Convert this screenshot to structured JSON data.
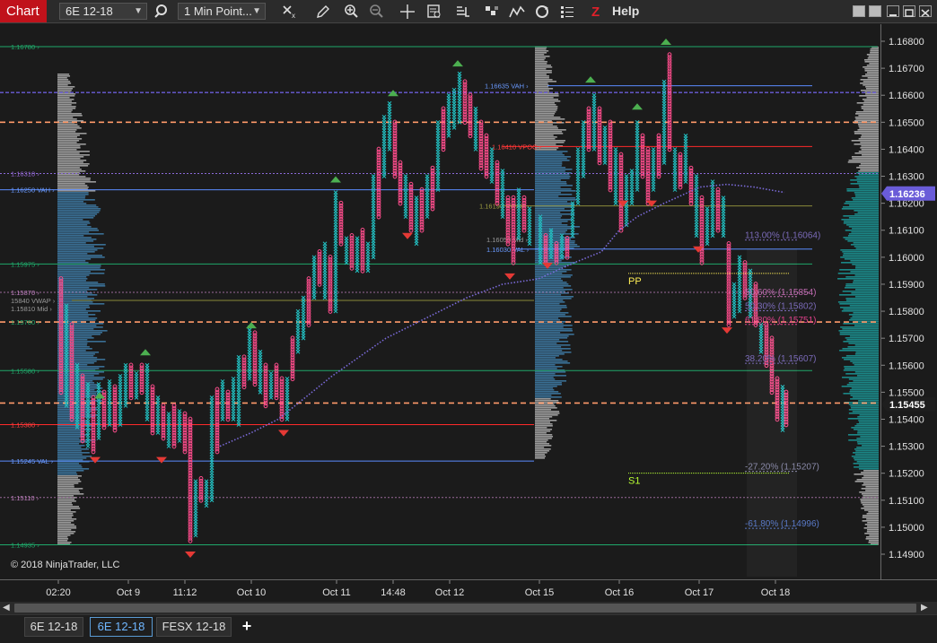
{
  "window": {
    "title": "Chart",
    "instrument": "6E 12-18",
    "interval": "1 Min Point...",
    "help_label": "Help"
  },
  "toolbar": {
    "icons": [
      "search-icon",
      "crosshair-remove-icon",
      "pencil-icon",
      "zoom-in-icon",
      "zoom-out-icon",
      "crosshair-icon",
      "data-box-icon",
      "bar-chart-icon",
      "strategy-icon",
      "indicator-icon",
      "refresh-icon",
      "properties-icon",
      "zlogo-icon"
    ]
  },
  "chart": {
    "copyright": "© 2018 NinjaTrader, LLC",
    "current_price_label": "1.16236",
    "last_price_label": "1.15455",
    "price_axis_ticks": [
      "1.16800",
      "1.16700",
      "1.16600",
      "1.16500",
      "1.16400",
      "1.16300",
      "1.16200",
      "1.16100",
      "1.16000",
      "1.15900",
      "1.15800",
      "1.15700",
      "1.15600",
      "1.15500",
      "1.15400",
      "1.15300",
      "1.15200",
      "1.15100",
      "1.15000",
      "1.14900"
    ],
    "time_axis_labels": [
      "02:20",
      "Oct 9",
      "11:12",
      "Oct 10",
      "Oct 11",
      "14:48",
      "Oct 12",
      "Oct 15",
      "Oct 16",
      "Oct 17",
      "Oct 18"
    ],
    "left_levels": [
      "1.16780",
      "1.16310",
      "1.16250 VAH",
      "1.15975",
      "1.15870",
      "15840 VWAP",
      "1.15810 Mid",
      "1.15760",
      "1.15580",
      "1.15380",
      "1.15245 VAL",
      "1.15110",
      "1.14935"
    ],
    "session_labels": [
      "1.16635 VAH",
      "1.16410 VPOC",
      "1.16190 VWAP",
      "1.16050 Mid",
      "1.16030 VAL"
    ],
    "fib_labels": [
      "113.00% (1.16064)",
      "50.60% (1.15854)",
      "50.30% (1.15802)",
      "61.80% (1.15751)",
      "38.20% (1.15607)",
      "-27.20% (1.15207)",
      "-61.80% (1.14996)"
    ],
    "pivot_labels": [
      "PP",
      "S1"
    ]
  },
  "tabs": [
    "6E 12-18",
    "6E 12-18",
    "FESX 12-18"
  ],
  "active_tab_index": 1,
  "colors": {
    "title_bg": "#c0121b",
    "x_color": "#22c1c3",
    "o_color": "#ff4d8d",
    "vah_line": "#5b8cff",
    "poc_line": "#ff2a2a",
    "dashed_orange": "#ff9a6a",
    "green_level": "#1fa86a",
    "profile_blue": "#3b6b8e",
    "profile_teal": "#1a8a8a"
  }
}
